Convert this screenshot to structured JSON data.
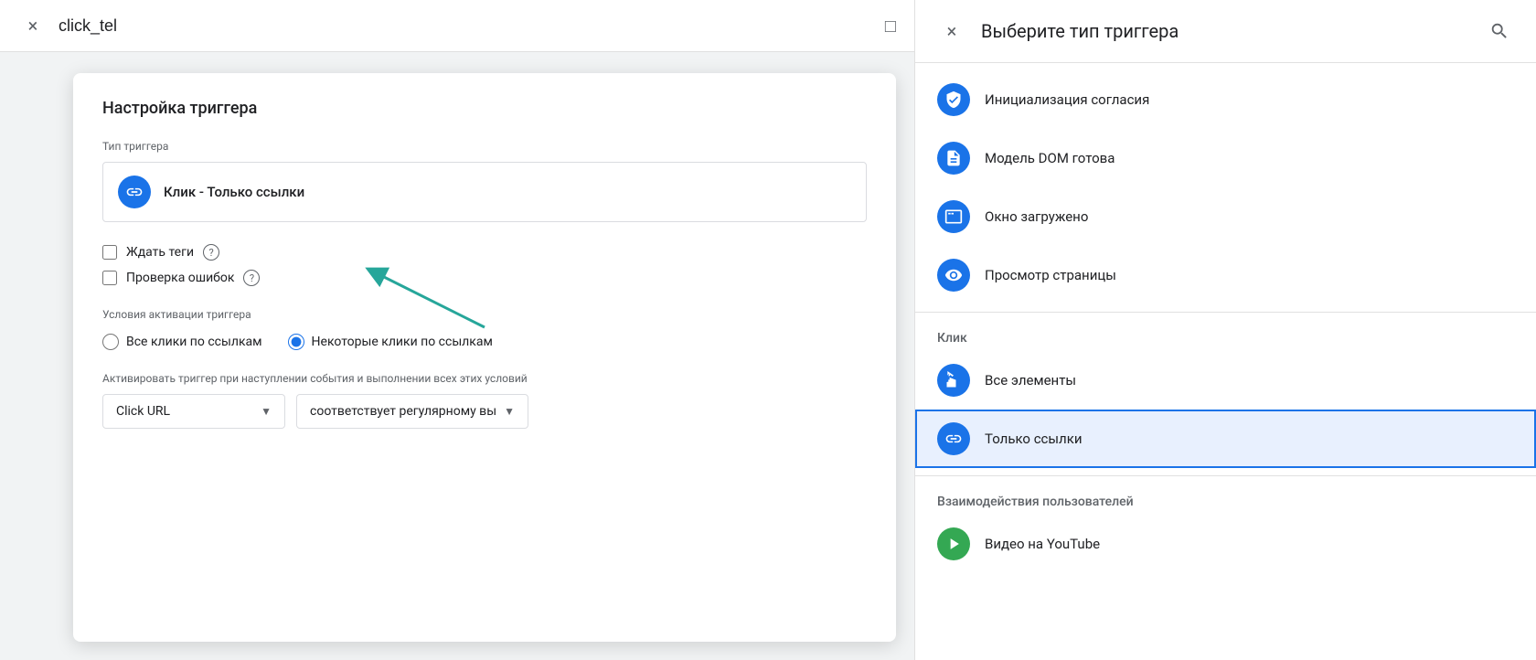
{
  "topbar": {
    "close_label": "×",
    "title": "click_tel",
    "folder_icon": "□"
  },
  "modal": {
    "title": "Настройка триггера",
    "trigger_type_label": "Тип триггера",
    "trigger_type_name": "Клик - Только ссылки",
    "wait_tags_label": "Ждать теги",
    "check_errors_label": "Проверка ошибок",
    "activation_label": "Условия активации триггера",
    "radio_all": "Все клики по ссылкам",
    "radio_some": "Некоторые клики по ссылкам",
    "condition_label": "Активировать триггер при наступлении события и выполнении всех этих условий",
    "condition_field": "Click URL",
    "condition_operator": "соответствует регулярному вы"
  },
  "right_panel": {
    "title": "Выберите тип триггера",
    "close_label": "×",
    "items": [
      {
        "id": "consent",
        "label": "Инициализация согласия",
        "icon_type": "shield",
        "color": "#1a73e8",
        "section": null
      },
      {
        "id": "dom_ready",
        "label": "Модель DOM готова",
        "icon_type": "doc",
        "color": "#1a73e8",
        "section": null
      },
      {
        "id": "window_loaded",
        "label": "Окно загружено",
        "icon_type": "window",
        "color": "#1a73e8",
        "section": null
      },
      {
        "id": "page_view",
        "label": "Просмотр страницы",
        "icon_type": "eye",
        "color": "#1a73e8",
        "section": null
      },
      {
        "id": "all_elements",
        "label": "Все элементы",
        "icon_type": "cursor",
        "color": "#1a73e8",
        "section": "Клик"
      },
      {
        "id": "only_links",
        "label": "Только ссылки",
        "icon_type": "link",
        "color": "#1a73e8",
        "section": null,
        "selected": true
      },
      {
        "id": "user_interactions",
        "label": "section_header",
        "section_title": "Взаимодействия пользователей"
      },
      {
        "id": "youtube",
        "label": "Видео на YouTube",
        "icon_type": "play",
        "color": "#34a853",
        "section": null
      }
    ],
    "section_click": "Клик",
    "section_user": "Взаимодействия пользователей"
  }
}
